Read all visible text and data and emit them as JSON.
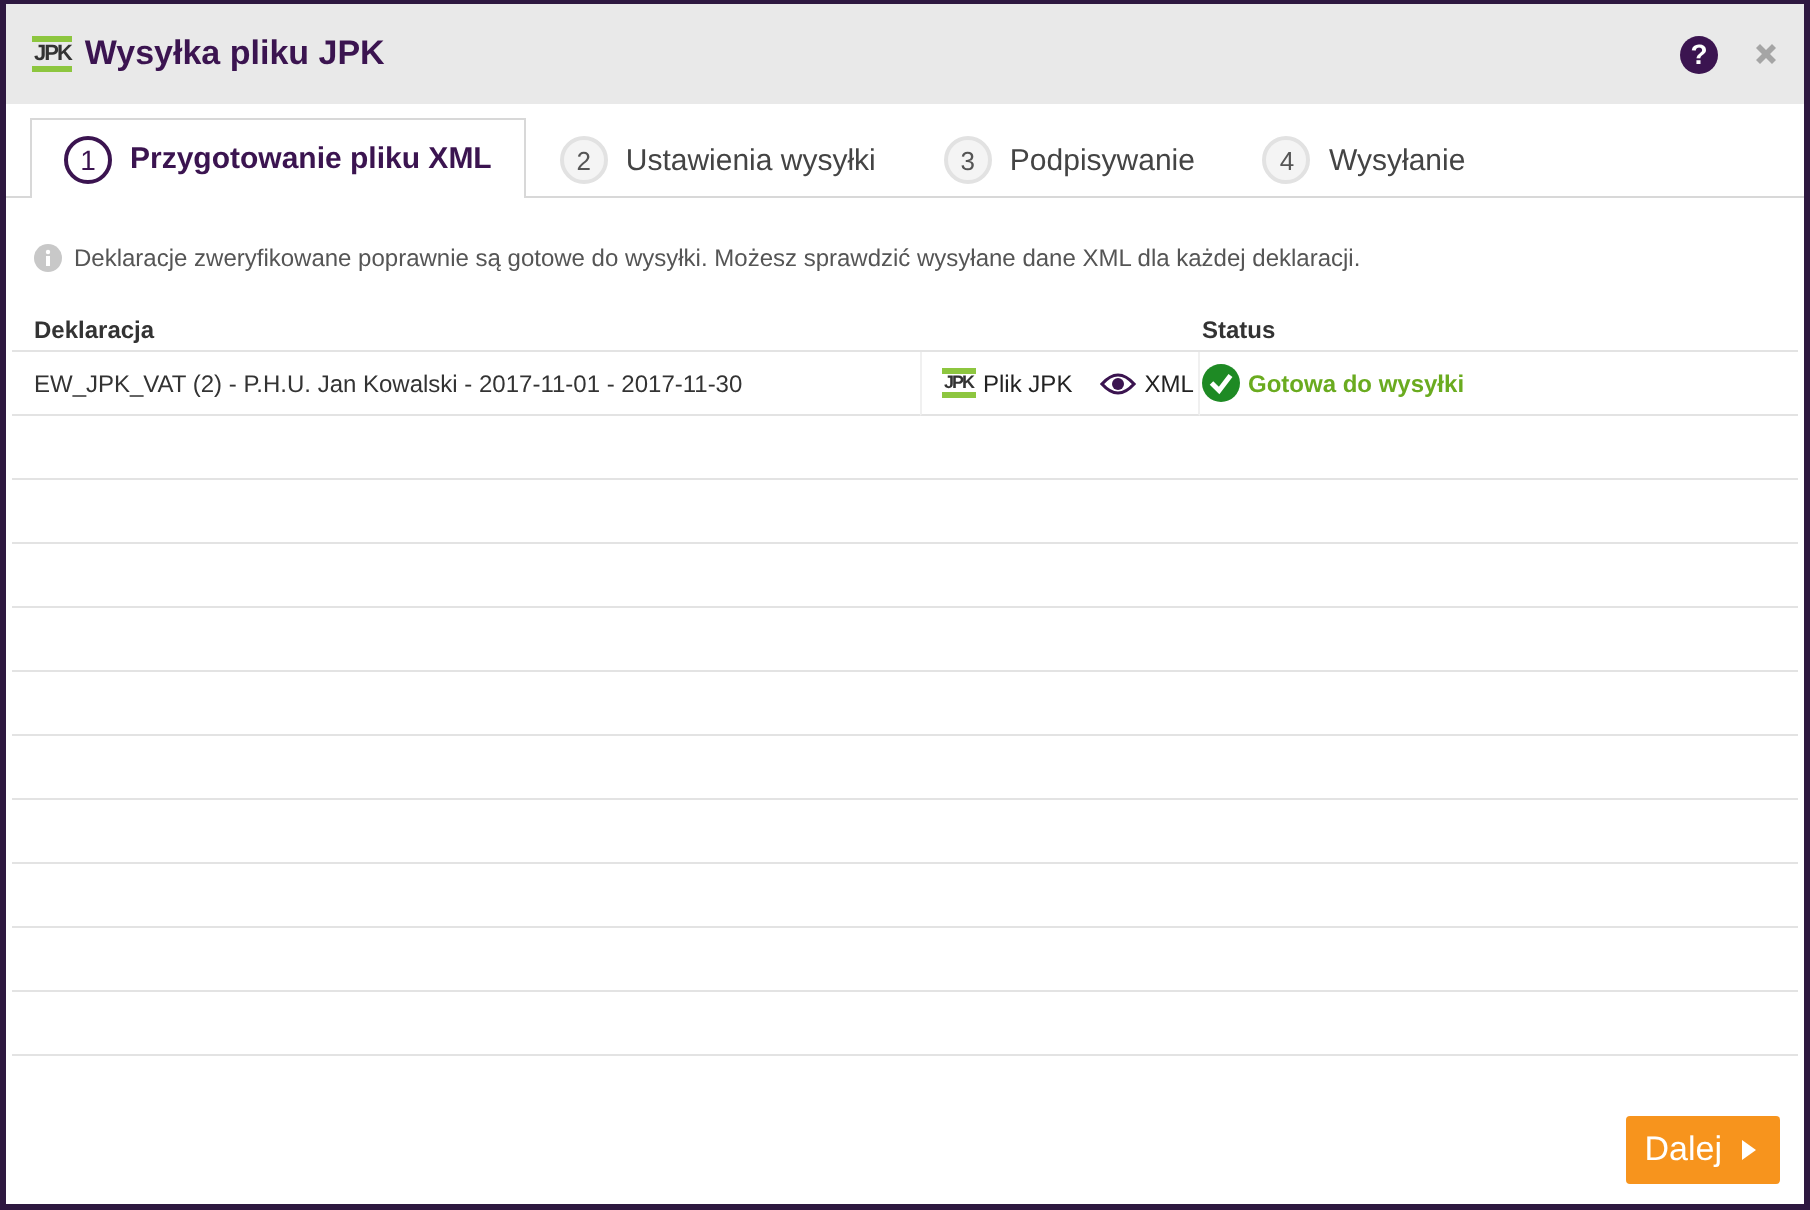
{
  "window": {
    "logo": "JPK",
    "title": "Wysyłka pliku JPK",
    "help": "?"
  },
  "tabs": [
    {
      "number": "1",
      "label": "Przygotowanie pliku XML",
      "selected": true
    },
    {
      "number": "2",
      "label": "Ustawienia wysyłki",
      "selected": false
    },
    {
      "number": "3",
      "label": "Podpisywanie",
      "selected": false
    },
    {
      "number": "4",
      "label": "Wysyłanie",
      "selected": false
    }
  ],
  "info": "Deklaracje zweryfikowane poprawnie są gotowe do wysyłki. Możesz sprawdzić wysyłane dane XML dla każdej deklaracji.",
  "table": {
    "columns": [
      "Deklaracja",
      "Status"
    ],
    "rows": [
      {
        "declaration": "EW_JPK_VAT (2) - P.H.U. Jan Kowalski - 2017-11-01 - 2017-11-30",
        "file_logo": "JPK",
        "file_link": "Plik JPK",
        "xml_link": "XML",
        "status": "Gotowa do wysyłki",
        "ready": true
      }
    ]
  },
  "next_button": "Dalej"
}
